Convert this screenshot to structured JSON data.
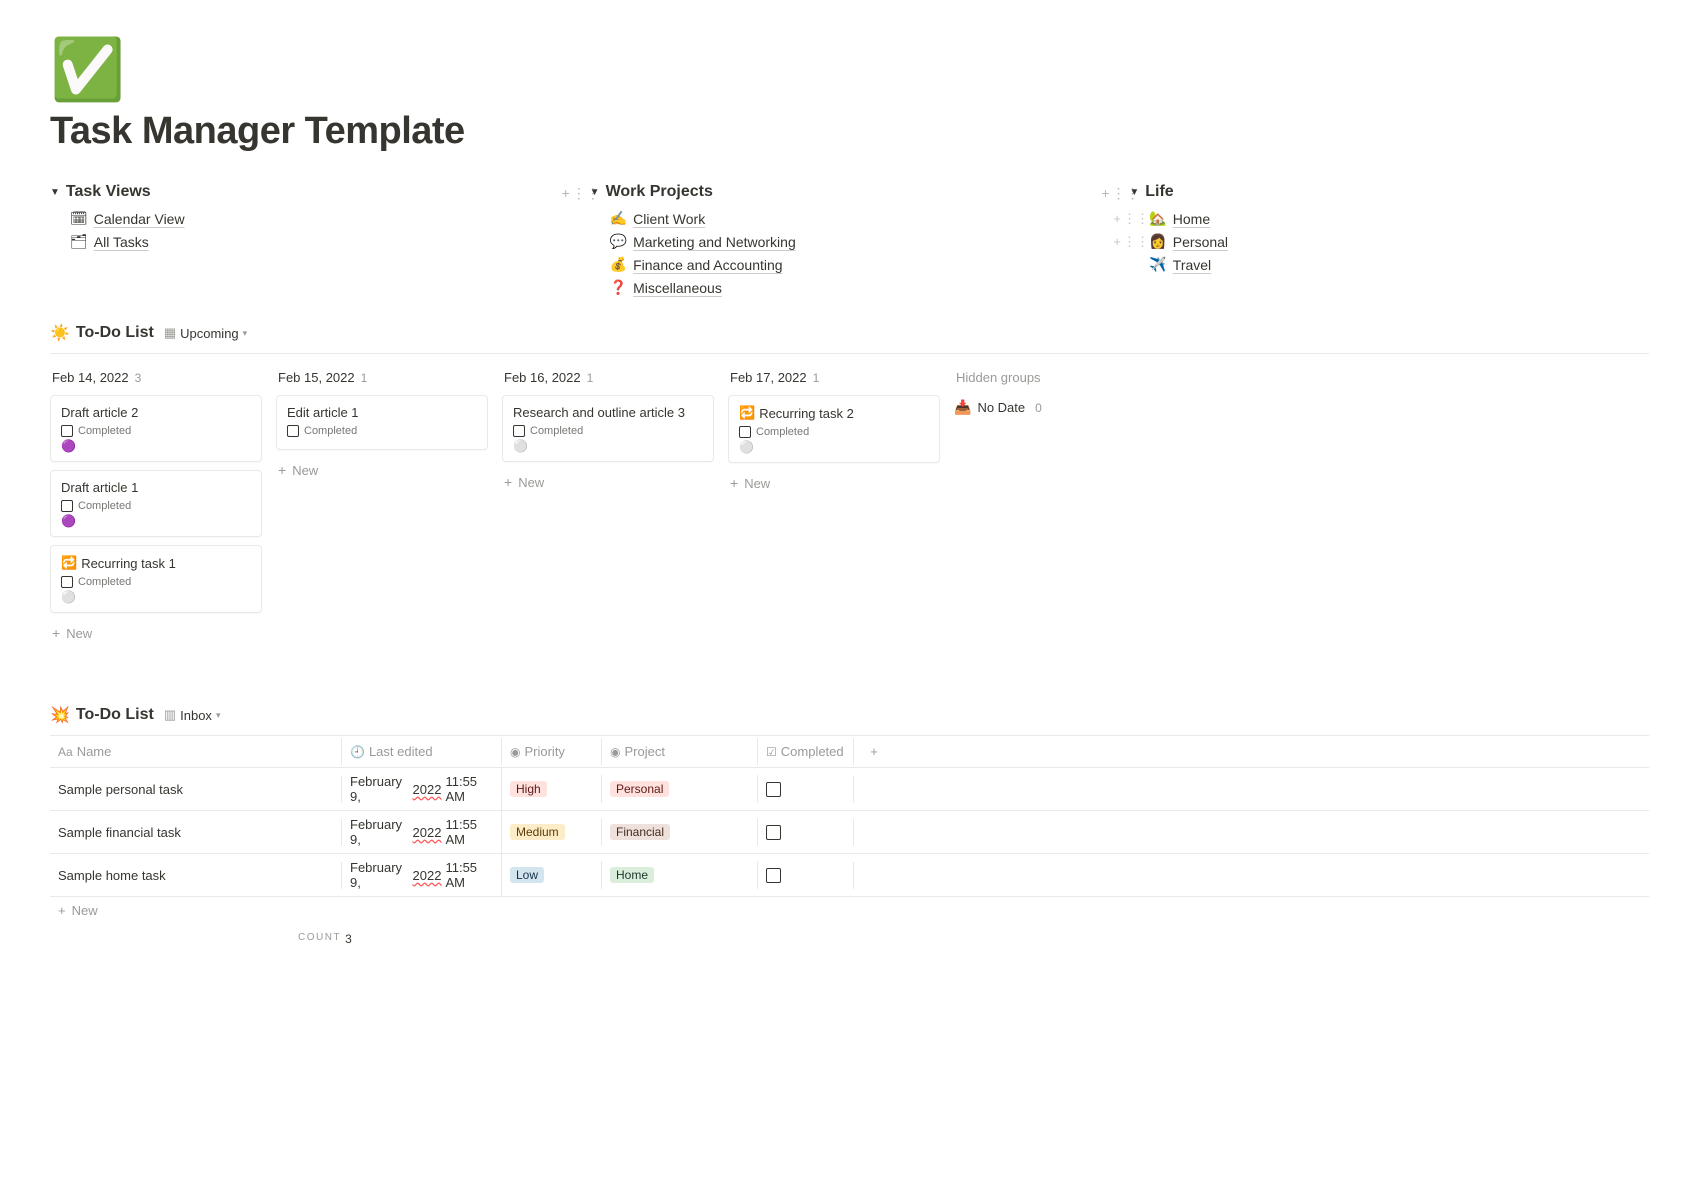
{
  "page": {
    "icon": "✅",
    "title": "Task Manager Template"
  },
  "nav": {
    "col1": {
      "heading": "Task Views",
      "items": [
        {
          "emoji": "🗓",
          "label": "Calendar View"
        },
        {
          "emoji": "🗂",
          "label": "All Tasks"
        }
      ]
    },
    "col2": {
      "heading": "Work Projects",
      "items": [
        {
          "emoji": "✍️",
          "label": "Client Work"
        },
        {
          "emoji": "💬",
          "label": "Marketing and Networking"
        },
        {
          "emoji": "💰",
          "label": "Finance and Accounting"
        },
        {
          "emoji": "❓",
          "label": "Miscellaneous"
        }
      ]
    },
    "col3": {
      "heading": "Life",
      "items": [
        {
          "emoji": "🏡",
          "label": "Home"
        },
        {
          "emoji": "👩",
          "label": "Personal"
        },
        {
          "emoji": "✈️",
          "label": "Travel"
        }
      ]
    }
  },
  "todo": {
    "title": "To-Do List",
    "icon": "☀️",
    "view_label": "Upcoming",
    "hidden_label": "Hidden groups",
    "no_date_label": "No Date",
    "no_date_count": "0",
    "new_label": "New",
    "completed_label": "Completed",
    "columns": [
      {
        "date": "Feb 14, 2022",
        "count": "3",
        "cards": [
          {
            "title": "Draft article 2",
            "icon": "",
            "dot": "🟣"
          },
          {
            "title": "Draft article 1",
            "icon": "",
            "dot": "🟣"
          },
          {
            "title": "Recurring task 1",
            "icon": "🔁",
            "dot": "⚪️"
          }
        ]
      },
      {
        "date": "Feb 15, 2022",
        "count": "1",
        "cards": [
          {
            "title": "Edit article 1",
            "icon": "",
            "dot": ""
          }
        ]
      },
      {
        "date": "Feb 16, 2022",
        "count": "1",
        "cards": [
          {
            "title": "Research and outline article 3",
            "icon": "",
            "dot": "⚪️"
          }
        ]
      },
      {
        "date": "Feb 17, 2022",
        "count": "1",
        "cards": [
          {
            "title": "Recurring task 2",
            "icon": "🔁",
            "dot": "⚪️"
          }
        ]
      }
    ]
  },
  "inbox": {
    "title": "To-Do List",
    "icon": "💥",
    "view_label": "Inbox",
    "new_label": "New",
    "count_label": "COUNT",
    "count_value": "3",
    "headers": {
      "name": "Name",
      "last_edited": "Last edited",
      "priority": "Priority",
      "project": "Project",
      "completed": "Completed"
    },
    "rows": [
      {
        "name": "Sample personal task",
        "edited_pre": "February 9, ",
        "edited_year": "2022",
        "edited_post": " 11:55 AM",
        "priority": "High",
        "priority_cls": "high",
        "project": "Personal",
        "project_cls": "personal"
      },
      {
        "name": "Sample financial task",
        "edited_pre": "February 9, ",
        "edited_year": "2022",
        "edited_post": " 11:55 AM",
        "priority": "Medium",
        "priority_cls": "medium",
        "project": "Financial",
        "project_cls": "financial"
      },
      {
        "name": "Sample home task",
        "edited_pre": "February 9, ",
        "edited_year": "2022",
        "edited_post": " 11:55 AM",
        "priority": "Low",
        "priority_cls": "low",
        "project": "Home",
        "project_cls": "home"
      }
    ]
  }
}
